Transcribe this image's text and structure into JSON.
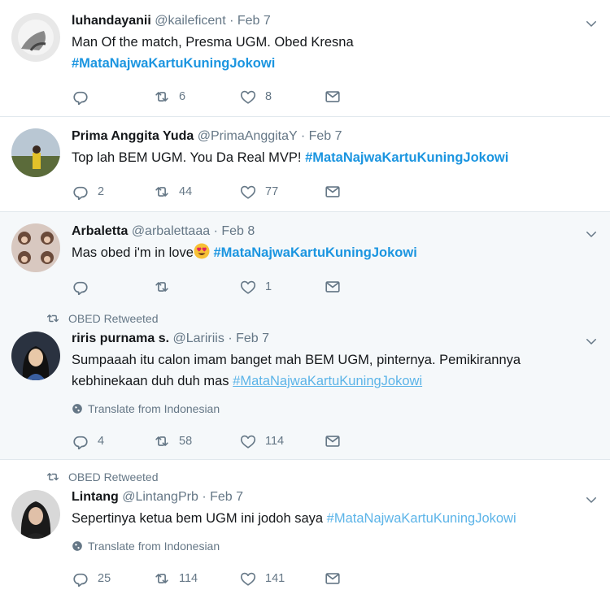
{
  "tweets": [
    {
      "name": "luhandayanii",
      "handle": "@kaileficent",
      "date": "Feb 7",
      "text_line1": "Man Of the match, Presma UGM. Obed Kresna",
      "hashtag": "#MataNajwaKartuKuningJokowi",
      "replies": "",
      "retweets": "6",
      "likes": "8"
    },
    {
      "name": "Prima Anggita Yuda",
      "handle": "@PrimaAnggitaY",
      "date": "Feb 7",
      "text": "Top lah BEM UGM. You Da Real MVP!",
      "hashtag": "#MataNajwaKartuKuningJokowi",
      "replies": "2",
      "retweets": "44",
      "likes": "77"
    },
    {
      "name": "Arbaletta",
      "handle": "@arbalettaaa",
      "date": "Feb 8",
      "text": "Mas obed i'm in love",
      "emoji": "heart-eyes-emoji",
      "hashtag": "#MataNajwaKartuKuningJokowi",
      "replies": "",
      "retweets": "",
      "likes": "1"
    },
    {
      "retweeted_by": "OBED Retweeted",
      "name": "riris purnama s.",
      "handle": "@Laririis",
      "date": "Feb 7",
      "text_line1": "Sumpaaah itu calon imam banget mah BEM UGM, pinternya. Pemikirannya",
      "text_line2": "kebhinekaan duh duh mas",
      "hashtag": "#MataNajwaKartuKuningJokowi",
      "translate": "Translate from Indonesian",
      "replies": "4",
      "retweets": "58",
      "likes": "114"
    },
    {
      "retweeted_by": "OBED Retweeted",
      "name": "Lintang",
      "handle": "@LintangPrb",
      "date": "Feb 7",
      "text": "Sepertinya ketua bem UGM ini jodoh saya",
      "hashtag": "#MataNajwaKartuKuningJokowi",
      "translate": "Translate from Indonesian",
      "replies": "25",
      "retweets": "114",
      "likes": "141"
    }
  ],
  "separator": "·",
  "colors": {
    "link": "#1b95e0",
    "muted": "#657786",
    "shaded_bg": "#f5f8fa",
    "border": "#e1e8ed"
  }
}
